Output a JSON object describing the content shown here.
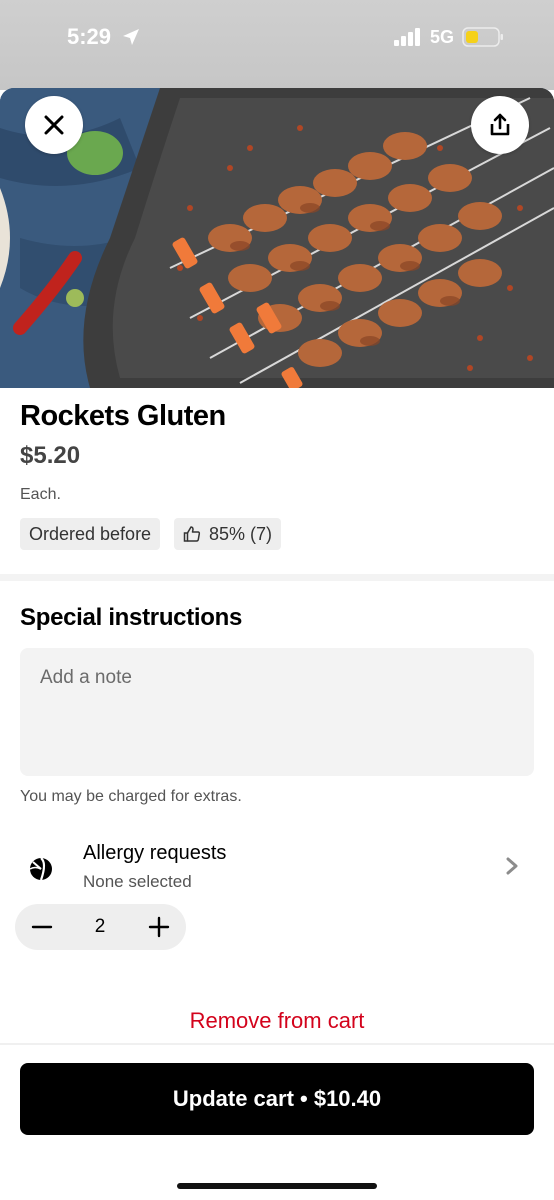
{
  "status_bar": {
    "time": "5:29",
    "network": "5G",
    "location_icon": "location-arrow-icon",
    "signal_icon": "signal-bars-icon",
    "battery_icon": "battery-icon",
    "battery_color": "#f5d11a"
  },
  "header": {
    "close_icon": "close-icon",
    "share_icon": "share-icon"
  },
  "item": {
    "name": "Rockets Gluten",
    "price": "$5.20",
    "unit": "Each.",
    "badges": {
      "ordered": "Ordered before",
      "rating": "85% (7)"
    }
  },
  "instructions": {
    "title": "Special instructions",
    "placeholder": "Add a note",
    "charge_note": "You may be charged for extras."
  },
  "allergy": {
    "title": "Allergy requests",
    "subtitle": "None selected",
    "icon": "allergy-icon"
  },
  "quantity": {
    "value": "2"
  },
  "actions": {
    "remove_label": "Remove from cart",
    "update_label": "Update cart • $10.40"
  },
  "colors": {
    "accent_red": "#d3031c",
    "primary_button": "#000000"
  }
}
